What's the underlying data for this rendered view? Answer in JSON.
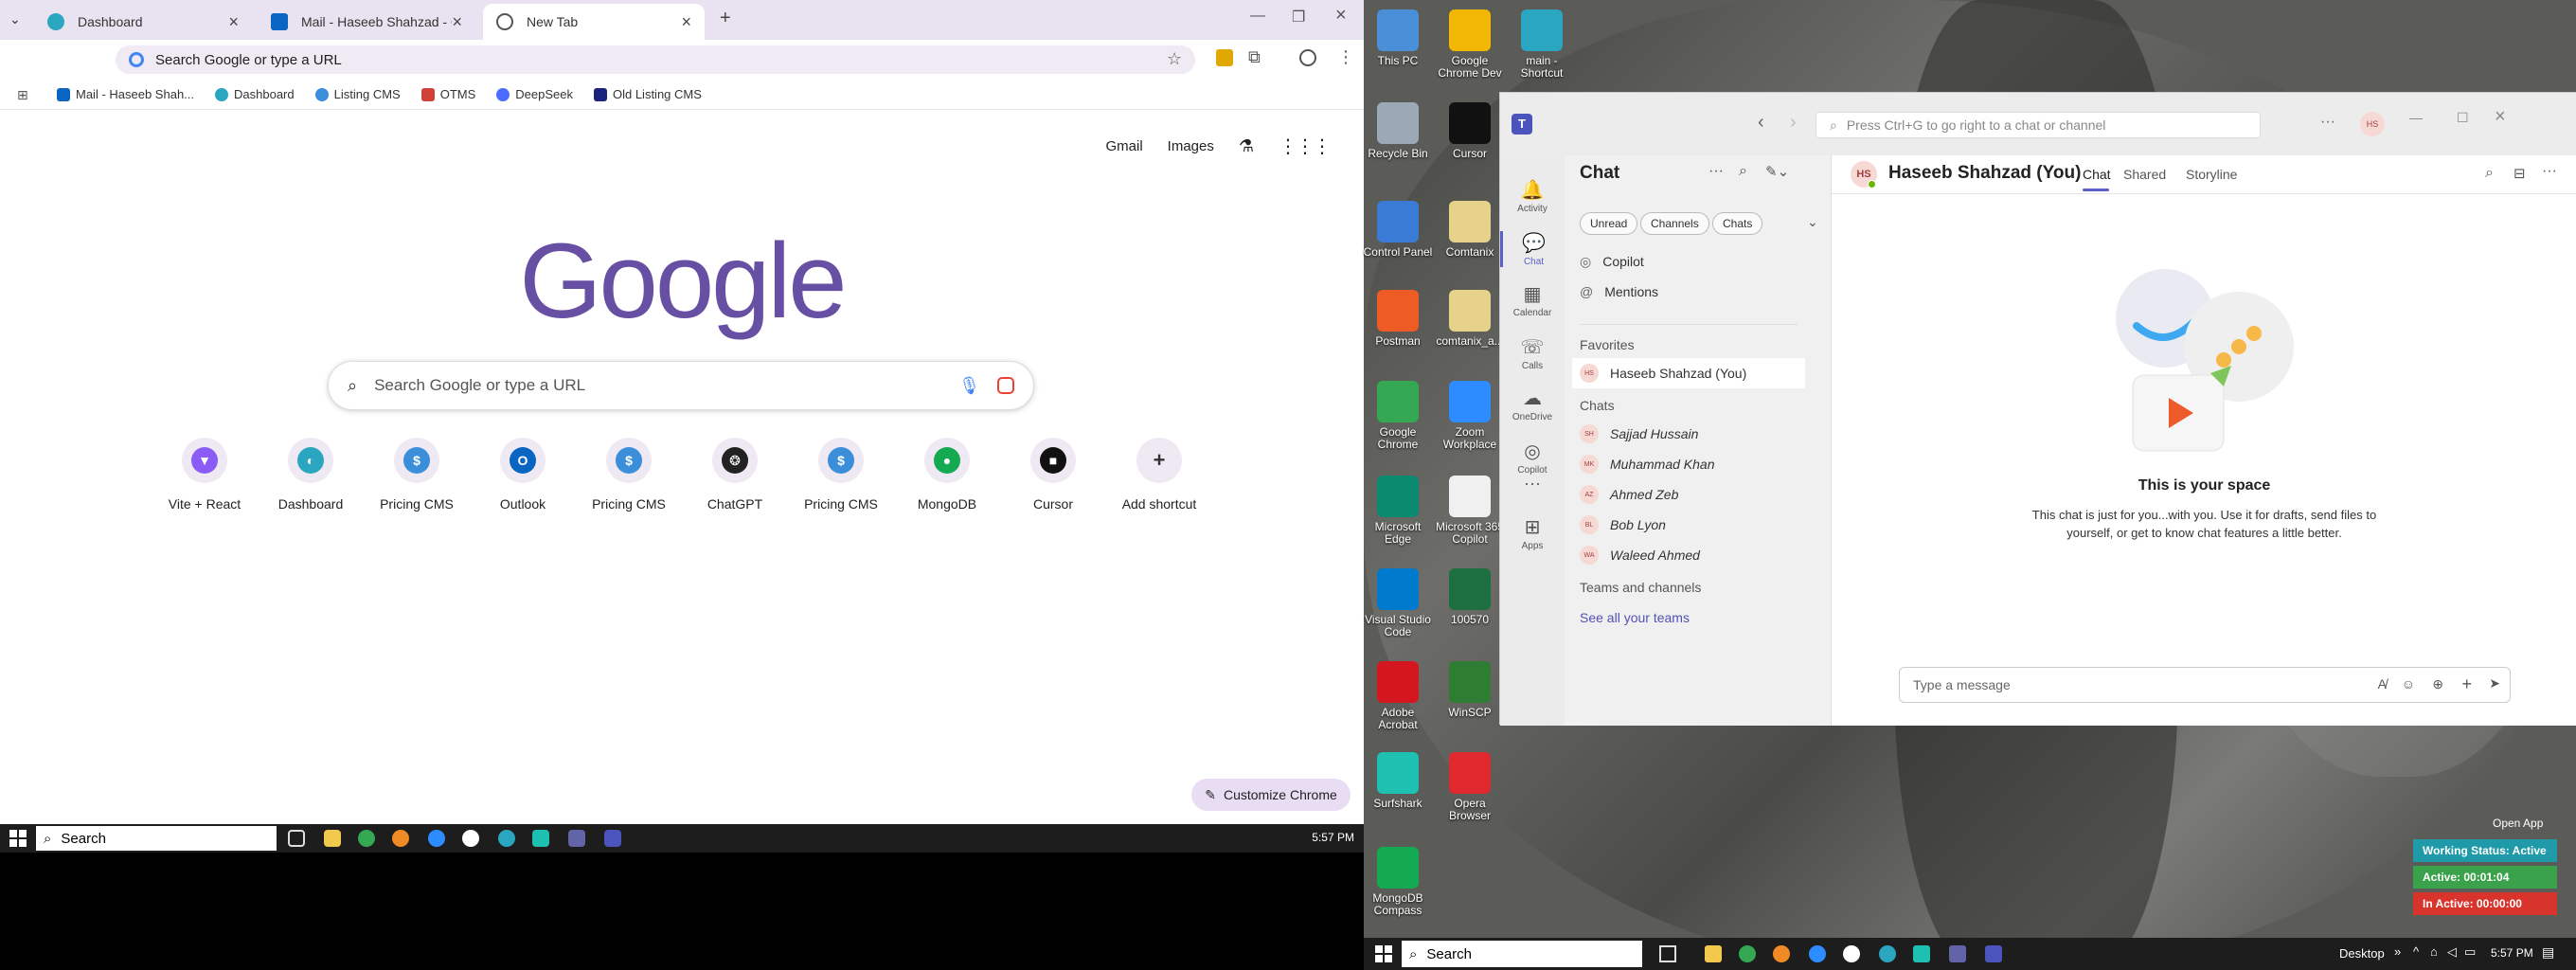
{
  "chrome": {
    "tabs": [
      {
        "title": "Dashboard",
        "color": "#2aa6c0"
      },
      {
        "title": "Mail - Haseeb Shahzad - Outlo",
        "color": "#0a64c2"
      },
      {
        "title": "New Tab",
        "color": "#555555"
      }
    ],
    "omnibox_text": "Search Google or type a URL",
    "bookmarks": [
      {
        "label": "Mail - Haseeb Shah...",
        "color": "#0a64c2"
      },
      {
        "label": "Dashboard",
        "color": "#2aa6c0"
      },
      {
        "label": "Listing CMS",
        "color": "#3b8fd9"
      },
      {
        "label": "OTMS",
        "color": "#d0413a"
      },
      {
        "label": "DeepSeek",
        "color": "#4d6bfe"
      },
      {
        "label": "Old Listing CMS",
        "color": "#1a237e"
      }
    ],
    "ntp_links": {
      "gmail": "Gmail",
      "images": "Images"
    },
    "logo": "Google",
    "search_placeholder": "Search Google or type a URL",
    "shortcuts": [
      {
        "label": "Vite + React",
        "glyph": "▼",
        "color": "#8b5cf6"
      },
      {
        "label": "Dashboard",
        "glyph": "◐",
        "color": "#2aa6c0"
      },
      {
        "label": "Pricing CMS",
        "glyph": "$",
        "color": "#3b8fd9"
      },
      {
        "label": "Outlook",
        "glyph": "O",
        "color": "#0a64c2"
      },
      {
        "label": "Pricing CMS",
        "glyph": "$",
        "color": "#3b8fd9"
      },
      {
        "label": "ChatGPT",
        "glyph": "❂",
        "color": "#222222"
      },
      {
        "label": "Pricing CMS",
        "glyph": "$",
        "color": "#3b8fd9"
      },
      {
        "label": "MongoDB",
        "glyph": "●",
        "color": "#13aa52"
      },
      {
        "label": "Cursor",
        "glyph": "■",
        "color": "#111111"
      },
      {
        "label": "Add shortcut",
        "glyph": "+",
        "color": "#eee9f2"
      }
    ],
    "customize_label": "Customize Chrome"
  },
  "taskbar1": {
    "search": "Search",
    "clock": "5:57 PM"
  },
  "desktop_icons": [
    {
      "label": "This PC",
      "color": "#4a90d9"
    },
    {
      "label": "Google Chrome Dev",
      "color": "#f2b705"
    },
    {
      "label": "main - Shortcut",
      "color": "#2aa6c0"
    },
    {
      "label": "Recycle Bin",
      "color": "#9aa9b5"
    },
    {
      "label": "Cursor",
      "color": "#111111"
    },
    {
      "label": "Control Panel",
      "color": "#3a7bd5"
    },
    {
      "label": "Comtanix",
      "color": "#e6d28a"
    },
    {
      "label": "Postman",
      "color": "#ef5b25"
    },
    {
      "label": "comtanix_a...",
      "color": "#e6d28a"
    },
    {
      "label": "Google Chrome",
      "color": "#34a853"
    },
    {
      "label": "Zoom Workplace",
      "color": "#2d8cff"
    },
    {
      "label": "Microsoft Edge",
      "color": "#0c8a6f"
    },
    {
      "label": "Microsoft 365 Copilot",
      "color": "#f0f0f0"
    },
    {
      "label": "Visual Studio Code",
      "color": "#007acc"
    },
    {
      "label": "100570",
      "color": "#1d6f42"
    },
    {
      "label": "Adobe Acrobat",
      "color": "#d4171e"
    },
    {
      "label": "WinSCP",
      "color": "#2e7d32"
    },
    {
      "label": "Surfshark",
      "color": "#1ec0b1"
    },
    {
      "label": "Opera Browser",
      "color": "#e0282f"
    },
    {
      "label": "MongoDB Compass",
      "color": "#13aa52"
    }
  ],
  "teams": {
    "search_placeholder": "Press Ctrl+G to go right to a chat or channel",
    "user_initials": "HS",
    "rail": [
      "Activity",
      "Chat",
      "Calendar",
      "Calls",
      "OneDrive",
      "Copilot",
      "Apps"
    ],
    "chat_heading": "Chat",
    "filters": [
      "Unread",
      "Channels",
      "Chats"
    ],
    "top_items": [
      "Copilot",
      "Mentions"
    ],
    "favorites_heading": "Favorites",
    "favorite": {
      "initials": "HS",
      "name": "Haseeb Shahzad (You)"
    },
    "chats_heading": "Chats",
    "chats": [
      {
        "initials": "SH",
        "name": "Sajjad Hussain"
      },
      {
        "initials": "MK",
        "name": "Muhammad Khan"
      },
      {
        "initials": "AZ",
        "name": "Ahmed Zeb"
      },
      {
        "initials": "BL",
        "name": "Bob Lyon"
      },
      {
        "initials": "WA",
        "name": "Waleed Ahmed"
      }
    ],
    "teams_heading": "Teams and channels",
    "see_all": "See all your teams",
    "conversation": {
      "initials": "HS",
      "title": "Haseeb Shahzad (You)",
      "tabs": [
        "Chat",
        "Shared",
        "Storyline"
      ],
      "empty_title": "This is your space",
      "empty_body_1": "This chat is just for you...with you. Use it for drafts, send files to",
      "empty_body_2": "yourself, or get to know chat features a little better.",
      "compose_placeholder": "Type a message"
    }
  },
  "taskbar2": {
    "search": "Search",
    "desktop": "Desktop",
    "clock": "5:57 PM"
  },
  "status_widget": {
    "open_app": "Open App",
    "working": "Working Status: Active",
    "active": "Active: 00:01:04",
    "inactive": "In Active: 00:00:00"
  }
}
